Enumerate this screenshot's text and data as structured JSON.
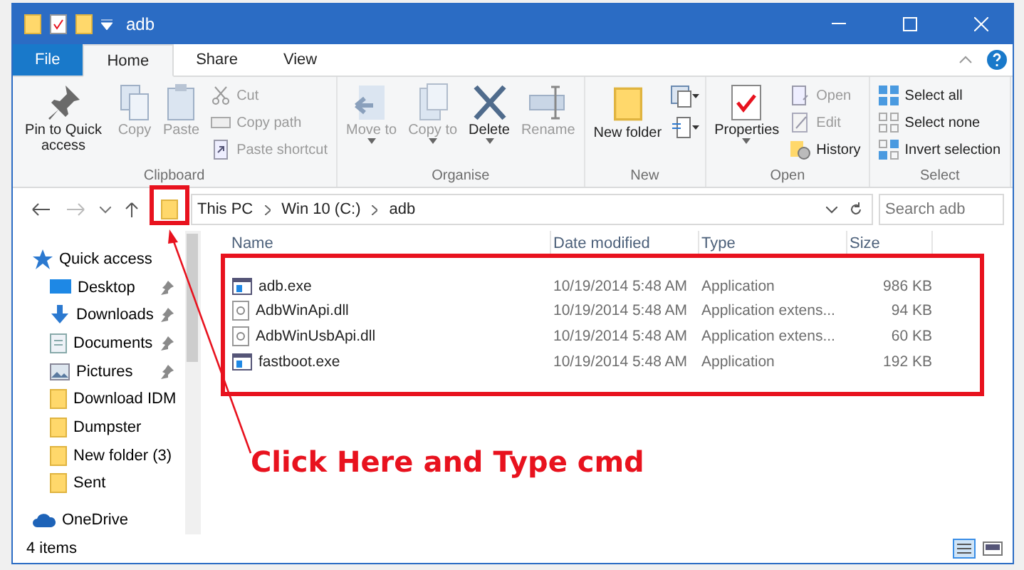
{
  "window": {
    "title": "adb"
  },
  "ribbon_tabs": [
    {
      "label": "File",
      "kind": "file",
      "selected": false
    },
    {
      "label": "Home",
      "kind": "tab",
      "selected": true
    },
    {
      "label": "Share",
      "kind": "tab",
      "selected": false
    },
    {
      "label": "View",
      "kind": "tab",
      "selected": false
    }
  ],
  "ribbon_groups": [
    {
      "label": "Clipboard",
      "items": [
        {
          "kind": "large",
          "label": "Pin to Quick access",
          "disabled": false
        },
        {
          "kind": "large",
          "label": "Copy",
          "disabled": true
        },
        {
          "kind": "large",
          "label": "Paste",
          "disabled": true
        },
        {
          "kind": "small",
          "entries": [
            {
              "label": "Cut",
              "disabled": true
            },
            {
              "label": "Copy path",
              "disabled": true
            },
            {
              "label": "Paste shortcut",
              "disabled": true
            }
          ]
        }
      ]
    },
    {
      "label": "Organise",
      "items": [
        {
          "kind": "large",
          "label": "Move to",
          "dropdown": true,
          "disabled": true
        },
        {
          "kind": "large",
          "label": "Copy to",
          "dropdown": true,
          "disabled": true
        },
        {
          "kind": "large",
          "label": "Delete",
          "dropdown": true,
          "disabled": false
        },
        {
          "kind": "large",
          "label": "Rename",
          "disabled": true
        }
      ]
    },
    {
      "label": "New",
      "items": [
        {
          "kind": "large",
          "label": "New folder",
          "disabled": false
        },
        {
          "kind": "icons"
        }
      ]
    },
    {
      "label": "Open",
      "items": [
        {
          "kind": "large",
          "label": "Properties",
          "dropdown": true,
          "disabled": false
        },
        {
          "kind": "small",
          "entries": [
            {
              "label": "Open",
              "disabled": true
            },
            {
              "label": "Edit",
              "disabled": true
            },
            {
              "label": "History",
              "disabled": false
            }
          ]
        }
      ]
    },
    {
      "label": "Select",
      "items": [
        {
          "kind": "small",
          "entries": [
            {
              "label": "Select all",
              "disabled": false
            },
            {
              "label": "Select none",
              "disabled": false
            },
            {
              "label": "Invert selection",
              "disabled": false
            }
          ]
        }
      ]
    }
  ],
  "address": {
    "path": [
      "This PC",
      "Win 10 (C:)",
      "adb"
    ],
    "search_placeholder": "Search adb"
  },
  "navigation": [
    {
      "label": "Quick access",
      "children": [
        {
          "label": "Desktop",
          "pinned": true
        },
        {
          "label": "Downloads",
          "pinned": true
        },
        {
          "label": "Documents",
          "pinned": true
        },
        {
          "label": "Pictures",
          "pinned": true
        },
        {
          "label": "Download IDM",
          "pinned": false
        },
        {
          "label": "Dumpster",
          "pinned": false
        },
        {
          "label": "New folder (3)",
          "pinned": false
        },
        {
          "label": "Sent",
          "pinned": false
        }
      ]
    },
    {
      "label": "OneDrive"
    }
  ],
  "table": {
    "columns": [
      "Name",
      "Date modified",
      "Type",
      "Size"
    ],
    "rows": [
      {
        "kind": "exe",
        "cells": [
          "adb.exe",
          "10/19/2014 5:48 AM",
          "Application",
          "986 KB"
        ]
      },
      {
        "kind": "dll",
        "cells": [
          "AdbWinApi.dll",
          "10/19/2014 5:48 AM",
          "Application extens...",
          "94 KB"
        ]
      },
      {
        "kind": "dll",
        "cells": [
          "AdbWinUsbApi.dll",
          "10/19/2014 5:48 AM",
          "Application extens...",
          "60 KB"
        ]
      },
      {
        "kind": "exe",
        "cells": [
          "fastboot.exe",
          "10/19/2014 5:48 AM",
          "Application",
          "192 KB"
        ]
      }
    ]
  },
  "status_bar": {
    "count": "4 items"
  },
  "annotation": {
    "text": "Click Here and Type cmd"
  }
}
